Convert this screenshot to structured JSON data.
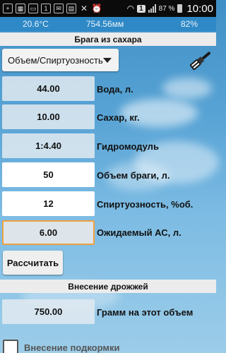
{
  "status_bar": {
    "battery": "87 %",
    "time": "10:00",
    "notification_badge": "1",
    "icons": [
      "plus-icon",
      "calendar-icon",
      "window-icon",
      "badge-1-icon",
      "mail-icon",
      "sim-icon",
      "muted-icon",
      "alarm-icon",
      "wifi-icon"
    ]
  },
  "weather": {
    "temperature": "20.6°C",
    "pressure": "754.56мм",
    "humidity": "82%"
  },
  "sections": {
    "main_title": "Брага из сахара",
    "yeast_title": "Внесение дрожжей"
  },
  "dropdown": {
    "selected": "Объем/Спиртуозность"
  },
  "fields": [
    {
      "value": "44.00",
      "label": "Вода, л."
    },
    {
      "value": "10.00",
      "label": "Сахар, кг."
    },
    {
      "value": "1:4.40",
      "label": "Гидромодуль"
    },
    {
      "value": "50",
      "label": "Объем браги, л."
    },
    {
      "value": "12",
      "label": "Спиртуозность, %об."
    },
    {
      "value": "6.00",
      "label": "Ожидаемый АС, л."
    }
  ],
  "calc_button": "Рассчитать",
  "yeast": {
    "value": "750.00",
    "label": "Грамм на этот объем"
  },
  "checkbox_label": "Внесение подкормки"
}
